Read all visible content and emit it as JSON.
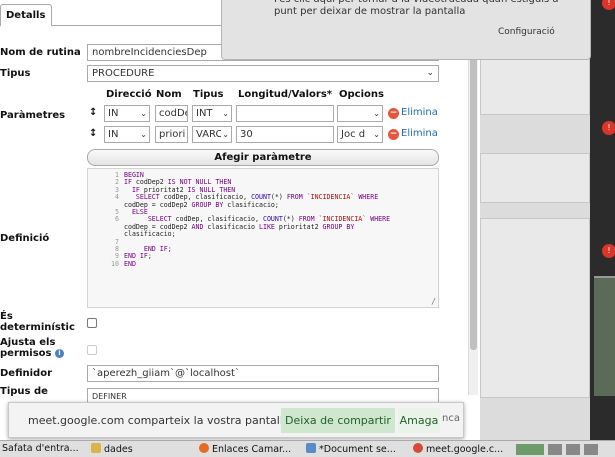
{
  "tab": "Detalls",
  "notification": {
    "message": "Fes clic aquí per tornar a la videotrucada quan estiguis a punt per deixar de mostrar la pantalla",
    "config": "Configuració"
  },
  "form": {
    "routine_name_label": "Nom de rutina",
    "routine_name": "nombreIncidenciesDep",
    "type_label": "Tipus",
    "type_value": "PROCEDURE",
    "params_label": "Paràmetres",
    "params_headers": [
      "Direcció",
      "Nom",
      "Tipus",
      "Longitud/Valors*",
      "Opcions"
    ],
    "params": [
      {
        "dir": "IN",
        "name": "codDe",
        "type": "INT",
        "length": "",
        "options": "",
        "delete": "Elimina"
      },
      {
        "dir": "IN",
        "name": "priori",
        "type": "VARC",
        "length": "30",
        "options": "Joc d",
        "delete": "Elimina"
      }
    ],
    "add_param": "Afegir paràmetre",
    "definition_label": "Definició",
    "code_lines": [
      {
        "n": "1",
        "t": "BEGIN"
      },
      {
        "n": "2",
        "t": "IF codDep2 IS NOT NULL THEN"
      },
      {
        "n": "3",
        "t": "  IF prioritat2 IS NULL THEN"
      },
      {
        "n": "4",
        "t": "   SELECT codDep, clasificacio, COUNT(*) FROM `INCIDENCIA` WHERE"
      },
      {
        "n": "",
        "t": "codDep = codDep2 GROUP BY clasificacio;"
      },
      {
        "n": "5",
        "t": "  ELSE"
      },
      {
        "n": "6",
        "t": "      SELECT codDep, clasificacio, COUNT(*) FROM `INCIDENCIA` WHERE"
      },
      {
        "n": "",
        "t": "codDep = codDep2 AND clasificacio LIKE prioritat2 GROUP BY"
      },
      {
        "n": "",
        "t": "clasificacio;"
      },
      {
        "n": "7",
        "t": ""
      },
      {
        "n": "8",
        "t": "     END IF;"
      },
      {
        "n": "9",
        "t": "END IF;"
      },
      {
        "n": "10",
        "t": "END"
      }
    ],
    "deterministic_label": "És determinístic",
    "adjust_perms_label": "Ajusta els permisos",
    "definer_label": "Definidor",
    "definer": "`aperezh_giiam`@`localhost`",
    "security_label": "Tipus de",
    "security_value": "DEFINER"
  },
  "sharebar": {
    "text": "meet.google.com comparteix la vostra pantalla.",
    "stop": "Deixa de compartir",
    "hide": "Amaga",
    "behind": "nca"
  },
  "taskbar": [
    {
      "label": "Safata d'entra...",
      "icon": "mail-icon",
      "color": "#3a6ea5"
    },
    {
      "label": "dades",
      "icon": "folder-icon",
      "color": "#d9b44a"
    },
    {
      "label": "Enlaces Camar...",
      "icon": "firefox-icon",
      "color": "#e66a1f"
    },
    {
      "label": "*Document se...",
      "icon": "document-icon",
      "color": "#5a8ac8"
    },
    {
      "label": "meet.google.c...",
      "icon": "chrome-icon",
      "color": "#d64a3a"
    }
  ]
}
